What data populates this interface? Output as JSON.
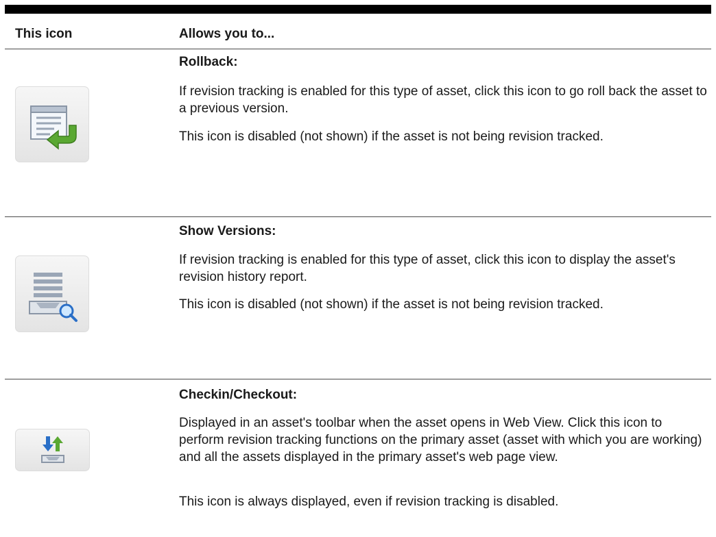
{
  "header": {
    "col_icon": "This icon",
    "col_desc": "Allows you to..."
  },
  "rows": [
    {
      "icon": "rollback-icon",
      "title": "Rollback:",
      "paragraphs": [
        "If revision tracking is enabled for this type of asset, click this icon to go roll back the asset to a previous version.",
        "This icon is disabled (not shown) if the asset is not being revision tracked."
      ]
    },
    {
      "icon": "show-versions-icon",
      "title": "Show Versions:",
      "paragraphs": [
        "If revision tracking is enabled for this type of asset, click this icon to display the asset's revision history report.",
        "This icon is disabled (not shown) if the asset is not being revision tracked."
      ]
    },
    {
      "icon": "checkin-checkout-icon",
      "title": "Checkin/Checkout:",
      "paragraphs": [
        "Displayed in an asset's toolbar when the asset opens in Web View. Click this icon to perform revision tracking functions on the primary asset (asset with which you are working) and all the assets displayed in the primary asset's web page view.",
        "This icon is always displayed, even if revision tracking is disabled."
      ]
    }
  ],
  "colors": {
    "rule": "#4a4a4a",
    "icon_green": "#5aa832",
    "icon_blue": "#2a6fc7"
  }
}
